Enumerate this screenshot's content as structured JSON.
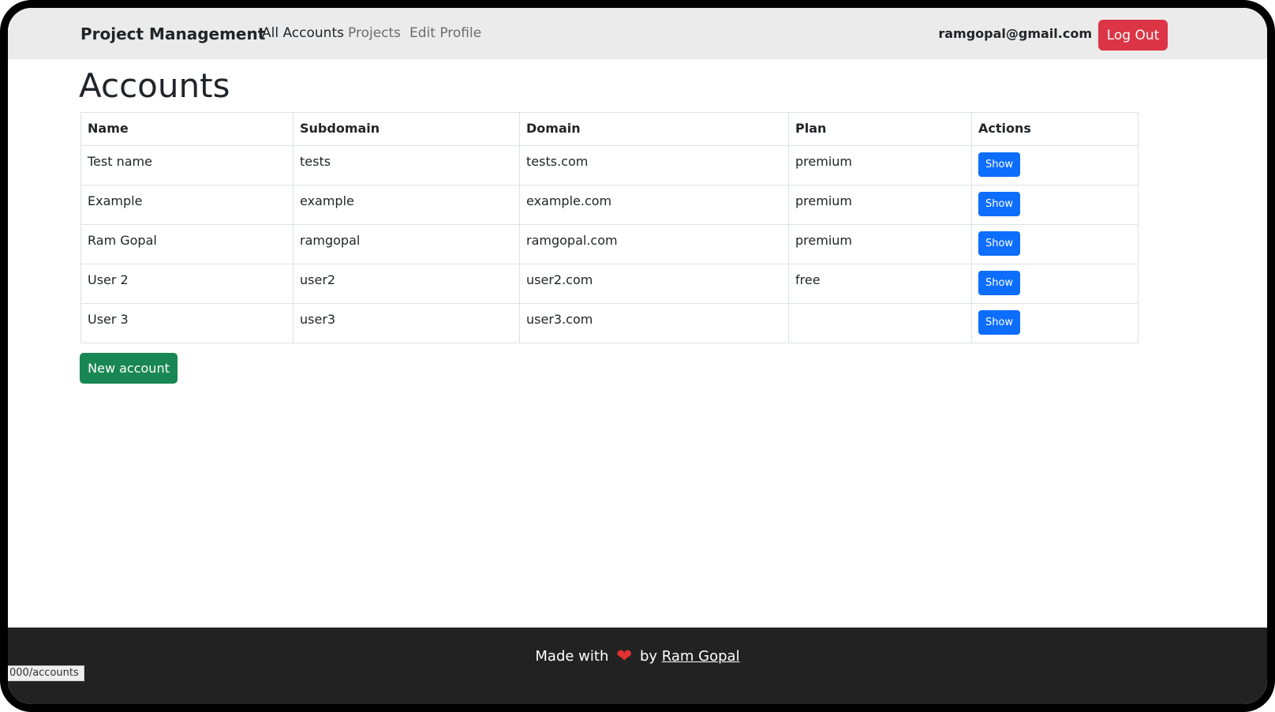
{
  "nav": {
    "brand": "Project Management",
    "links": [
      {
        "label": "All Accounts",
        "active": true
      },
      {
        "label": "Projects",
        "active": false
      },
      {
        "label": "Edit Profile",
        "active": false
      }
    ],
    "user_email": "ramgopal@gmail.com",
    "logout_label": "Log Out"
  },
  "page": {
    "title": "Accounts"
  },
  "table": {
    "headers": [
      "Name",
      "Subdomain",
      "Domain",
      "Plan",
      "Actions"
    ],
    "show_label": "Show",
    "rows": [
      {
        "name": "Test name",
        "subdomain": "tests",
        "domain": "tests.com",
        "plan": "premium"
      },
      {
        "name": "Example",
        "subdomain": "example",
        "domain": "example.com",
        "plan": "premium"
      },
      {
        "name": "Ram Gopal",
        "subdomain": "ramgopal",
        "domain": "ramgopal.com",
        "plan": "premium"
      },
      {
        "name": "User 2",
        "subdomain": "user2",
        "domain": "user2.com",
        "plan": "free"
      },
      {
        "name": "User 3",
        "subdomain": "user3",
        "domain": "user3.com",
        "plan": ""
      }
    ]
  },
  "actions": {
    "new_account_label": "New account"
  },
  "footer": {
    "made_with": "Made with",
    "heart_icon": "heart-icon",
    "by": "by",
    "author_link": "Ram Gopal"
  },
  "status_bar": {
    "url": "000/accounts"
  },
  "colors": {
    "navbar_bg": "#ebebeb",
    "logout": "#dc3545",
    "show": "#0d6efd",
    "new_account": "#198754",
    "footer_bg": "#222222",
    "heart": "#e0302f"
  }
}
